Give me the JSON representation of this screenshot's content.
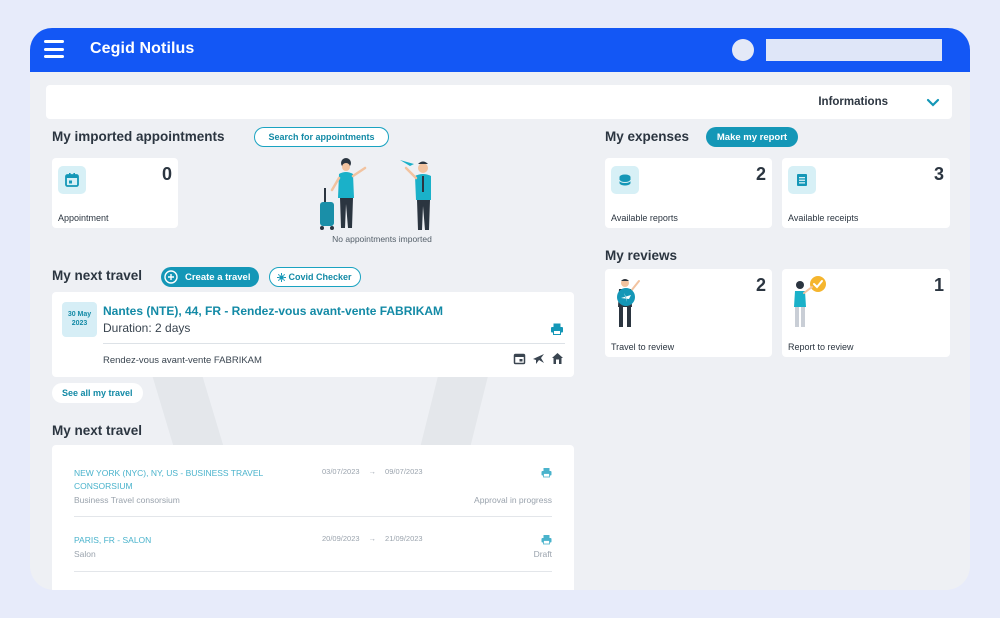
{
  "app": {
    "brand": "Cegid Notilus"
  },
  "info_bar": {
    "label": "Informations"
  },
  "appointments": {
    "title": "My imported appointments",
    "search_button": "Search for appointments",
    "card": {
      "count": "0",
      "label": "Appointment"
    },
    "empty_text": "No appointments imported"
  },
  "expenses": {
    "title": "My expenses",
    "report_button": "Make my report",
    "cards": [
      {
        "count": "2",
        "label": "Available reports"
      },
      {
        "count": "3",
        "label": "Available receipts"
      }
    ]
  },
  "reviews": {
    "title": "My reviews",
    "cards": [
      {
        "count": "2",
        "label": "Travel to review"
      },
      {
        "count": "1",
        "label": "Report to review"
      }
    ]
  },
  "next_travel": {
    "title": "My next travel",
    "create_button": "Create a travel",
    "covid_button": "Covid Checker",
    "trip": {
      "date_day": "30 May",
      "date_year": "2023",
      "title": "Nantes (NTE), 44, FR - Rendez-vous avant-vente FABRIKAM",
      "duration": "Duration: 2 days",
      "subtitle": "Rendez-vous avant-vente FABRIKAM"
    },
    "see_all": "See all my travel"
  },
  "travel_list": {
    "title": "My next travel",
    "rows": [
      {
        "title": "NEW YORK (NYC), NY, US - BUSINESS TRAVEL CONSORSIUM",
        "subtitle": "Business Travel consorsium",
        "start": "03/07/2023",
        "arrow": "→",
        "end": "09/07/2023",
        "status": "Approval in progress"
      },
      {
        "title": "PARIS, FR - SALON",
        "subtitle": "Salon",
        "start": "20/09/2023",
        "arrow": "→",
        "end": "21/09/2023",
        "status": "Draft"
      }
    ]
  },
  "colors": {
    "primary": "#1357f5",
    "accent": "#1497b7",
    "background": "#eef0f4"
  },
  "icons": [
    "menu-icon",
    "chevron-down-icon",
    "calendar-icon",
    "coins-icon",
    "receipt-icon",
    "plus-circle-icon",
    "virus-icon",
    "print-icon",
    "plane-icon",
    "hotel-icon"
  ]
}
